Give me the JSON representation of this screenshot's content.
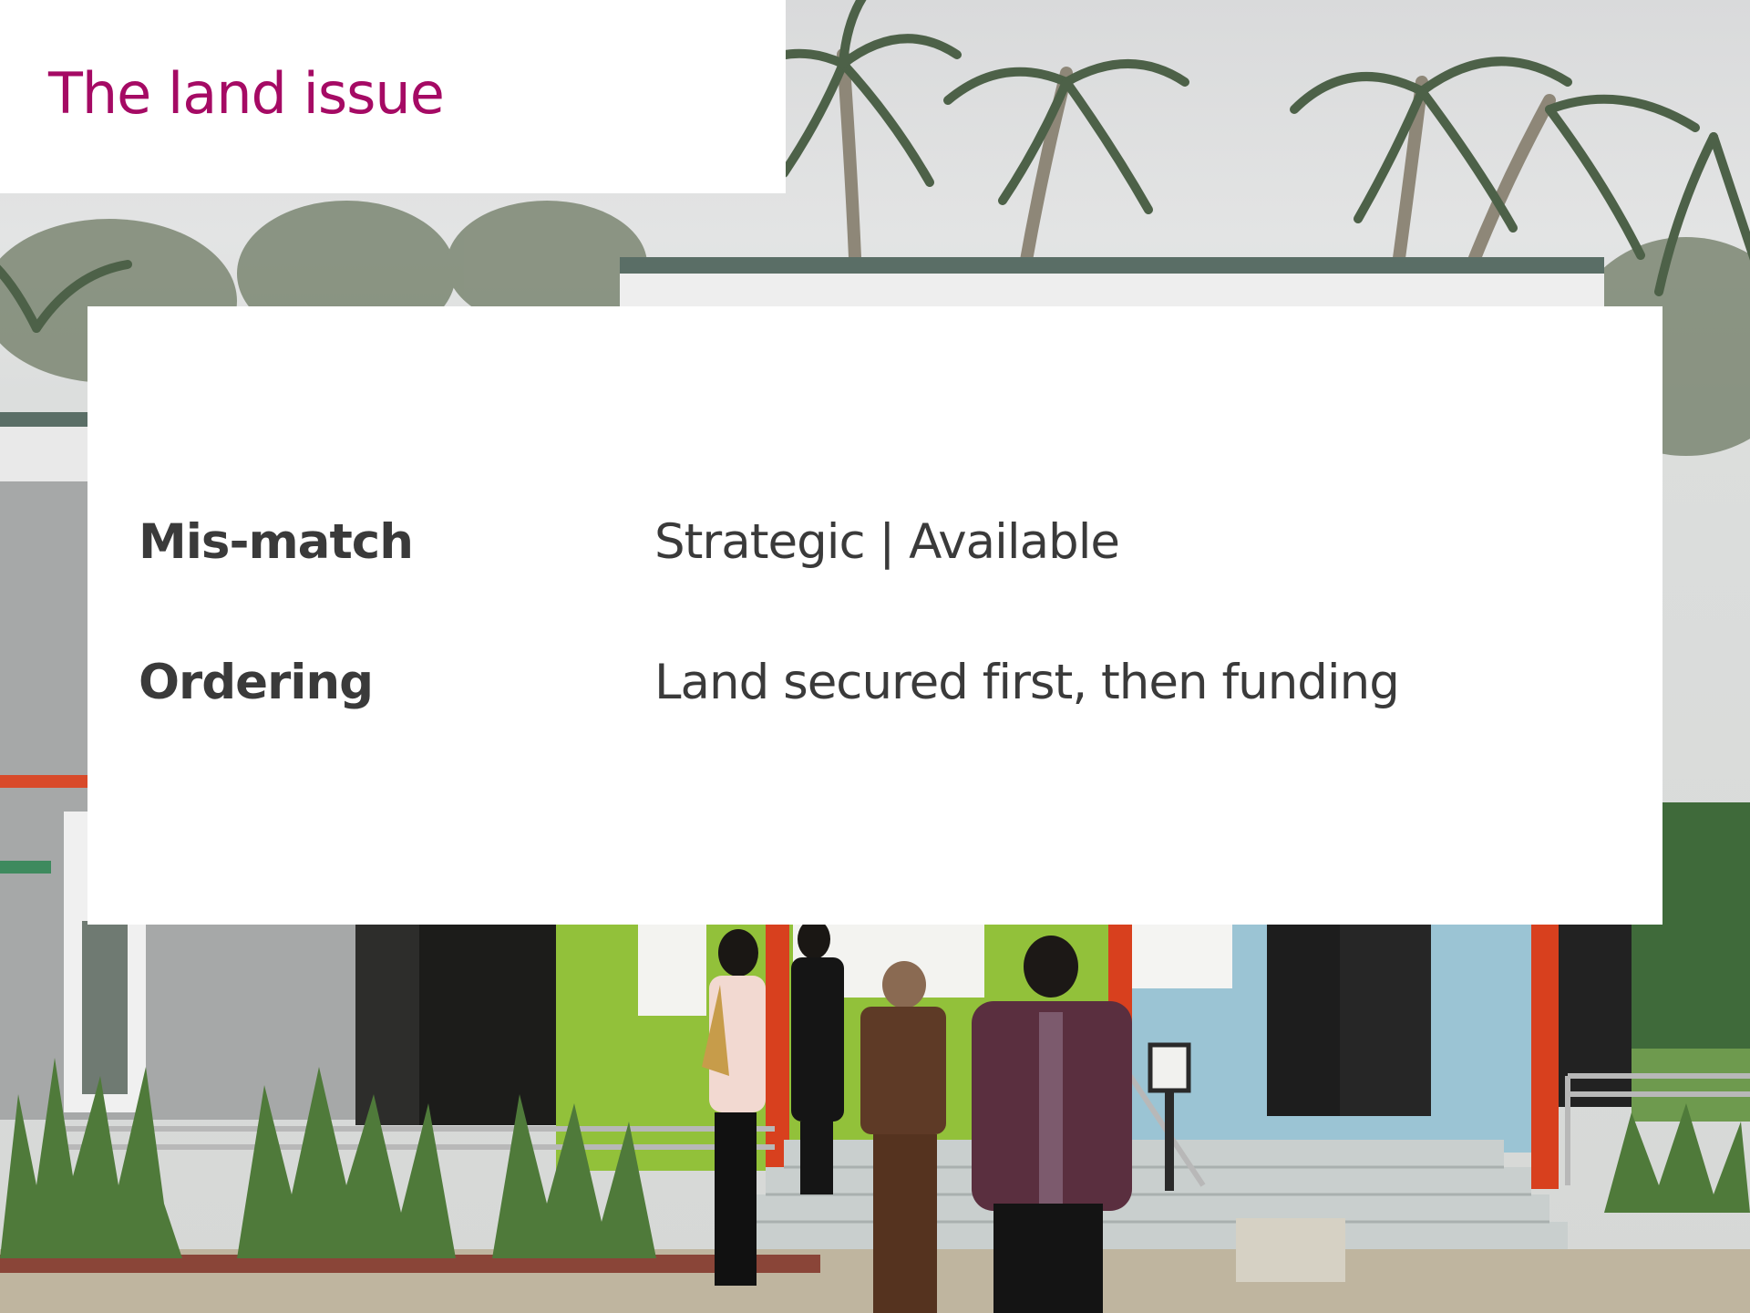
{
  "slide": {
    "title": "The land issue",
    "items": [
      {
        "label": "Mis-match",
        "value": "Strategic | Available"
      },
      {
        "label": "Ordering",
        "value": "Land secured first, then funding"
      }
    ]
  },
  "colors": {
    "title": "#a50a64",
    "text": "#3a3a3a",
    "panel": "#ffffff"
  }
}
